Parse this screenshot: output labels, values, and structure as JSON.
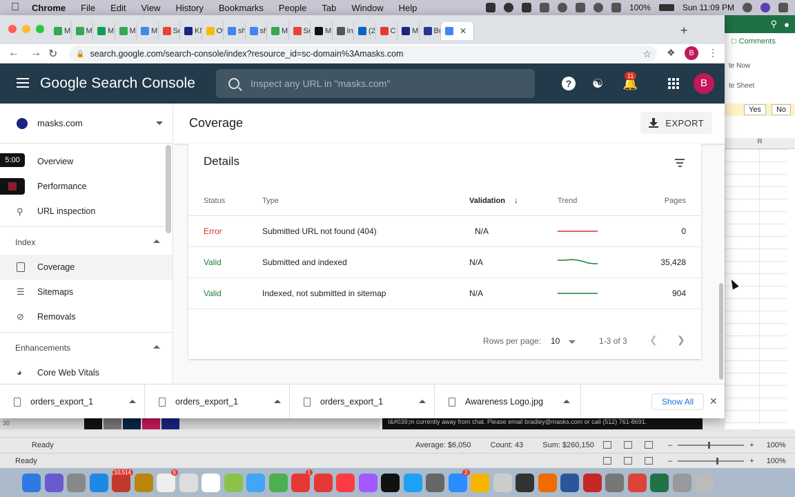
{
  "menubar": {
    "app": "Chrome",
    "items": [
      "File",
      "Edit",
      "View",
      "History",
      "Bookmarks",
      "People",
      "Tab",
      "Window",
      "Help"
    ],
    "battery": "100%",
    "clock": "Sun 11:09 PM"
  },
  "browser": {
    "tabs": [
      {
        "label": "M",
        "color": "#34a853"
      },
      {
        "label": "M",
        "color": "#34a853"
      },
      {
        "label": "M",
        "color": "#0f9d58"
      },
      {
        "label": "M",
        "color": "#34a853"
      },
      {
        "label": "M",
        "color": "#4285f4"
      },
      {
        "label": "Se",
        "color": "#ea4335"
      },
      {
        "label": "KN",
        "color": "#1a237e"
      },
      {
        "label": "Ov",
        "color": "#fbbc04"
      },
      {
        "label": "sh",
        "color": "#4285f4"
      },
      {
        "label": "sh",
        "color": "#4285f4"
      },
      {
        "label": "M",
        "color": "#34a853"
      },
      {
        "label": "Se",
        "color": "#ea4335"
      },
      {
        "label": "M",
        "color": "#111111"
      },
      {
        "label": "Inv",
        "color": "#555555"
      },
      {
        "label": "(2",
        "color": "#0a66c2"
      },
      {
        "label": "C",
        "color": "#e53935"
      },
      {
        "label": "M",
        "color": "#1a237e"
      },
      {
        "label": "Bu",
        "color": "#283593"
      }
    ],
    "url": "search.google.com/search-console/index?resource_id=sc-domain%3Amasks.com",
    "profile_initial": "B"
  },
  "gsc": {
    "logo": "Google Search Console",
    "search_placeholder": "Inspect any URL in \"masks.com\"",
    "notification_count": "11",
    "avatar_initial": "B",
    "property": "masks.com",
    "nav": {
      "overview": "Overview",
      "performance": "Performance",
      "url_inspection": "URL inspection",
      "index_section": "Index",
      "coverage": "Coverage",
      "sitemaps": "Sitemaps",
      "removals": "Removals",
      "enhancements_section": "Enhancements",
      "core_web_vitals": "Core Web Vitals"
    },
    "timer": "5:00",
    "page_title": "Coverage",
    "export_label": "EXPORT",
    "details": {
      "title": "Details",
      "columns": {
        "status": "Status",
        "type": "Type",
        "validation": "Validation",
        "trend": "Trend",
        "pages": "Pages"
      },
      "rows": [
        {
          "status": "Error",
          "type": "Submitted URL not found (404)",
          "validation": "N/A",
          "pages": "0",
          "trend_color": "#d93025"
        },
        {
          "status": "Valid",
          "type": "Submitted and indexed",
          "validation": "N/A",
          "pages": "35,428",
          "trend_color": "#188038"
        },
        {
          "status": "Valid",
          "type": "Indexed, not submitted in sitemap",
          "validation": "N/A",
          "pages": "904",
          "trend_color": "#188038"
        }
      ],
      "rows_per_page_label": "Rows per page:",
      "rows_per_page": "10",
      "range": "1-3 of 3"
    }
  },
  "downloads": {
    "items": [
      "orders_export_1",
      "orders_export_1",
      "orders_export_1",
      "Awareness Logo.jpg"
    ],
    "show_all": "Show All"
  },
  "excel": {
    "comments": "Comments",
    "hint1": "te Now",
    "hint2": "te Sheet",
    "yes": "Yes",
    "no": "No",
    "col": "R",
    "status1": {
      "ready": "Ready",
      "average": "Average: $6,050",
      "count": "Count: 43",
      "sum": "Sum: $260,150",
      "zoom": "100%"
    },
    "status2": {
      "ready": "Ready",
      "zoom": "100%"
    },
    "chat_banner": "I&#039;m currently away from chat. Please email bradley@masks.com or call (512) 761-8691.",
    "row_label": "30"
  },
  "dock": {
    "apps": [
      "#2d7be0",
      "#6a5acd",
      "#888888",
      "#1e88e5",
      "#c0392b",
      "#b8860b",
      "#eeeeee",
      "#dddddd",
      "#ffffff",
      "#8bc34a",
      "#42a5f5",
      "#4caf50",
      "#e53935",
      "#e53935",
      "#fc3c44",
      "#a259ff",
      "#111111",
      "#1da1f2",
      "#666666",
      "#2d8cff",
      "#f4b400",
      "#cccccc",
      "#333333",
      "#ef6c00",
      "#2b579a",
      "#c62828",
      "#777777",
      "#db4437",
      "#217346",
      "#999999",
      "#bbbbbb"
    ],
    "badges": {
      "mail": "10,514",
      "calendar": "6",
      "facetime": "1",
      "appstore": "2"
    }
  }
}
